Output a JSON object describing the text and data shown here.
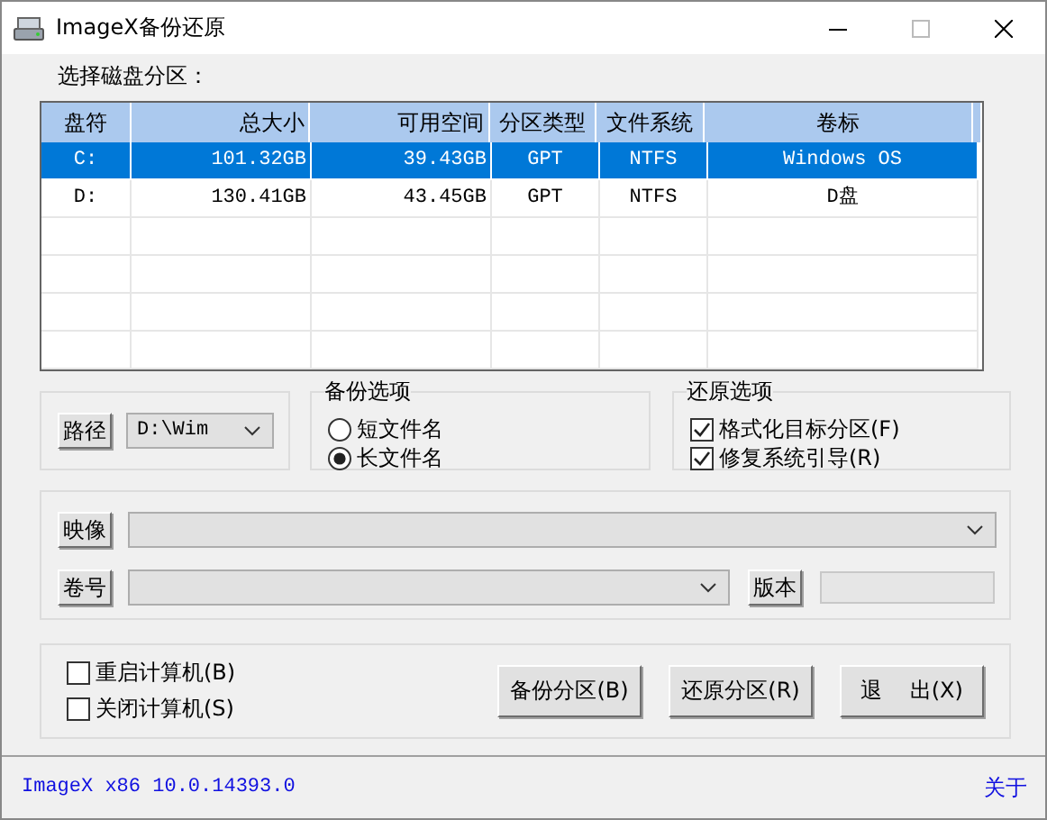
{
  "window": {
    "title": "ImageX备份还原"
  },
  "partition_label": "选择磁盘分区：",
  "table": {
    "columns": [
      "盘符",
      "总大小",
      "可用空间",
      "分区类型",
      "文件系统",
      "卷标"
    ],
    "rows": [
      {
        "selected": true,
        "cells": [
          "C:",
          "101.32GB",
          "39.43GB",
          "GPT",
          "NTFS",
          "Windows OS"
        ]
      },
      {
        "selected": false,
        "cells": [
          "D:",
          "130.41GB",
          "43.45GB",
          "GPT",
          "NTFS",
          "D盘"
        ]
      }
    ]
  },
  "path": {
    "button": "路径",
    "value": "D:\\Wim"
  },
  "backup_options": {
    "title": "备份选项",
    "options": [
      {
        "label": "短文件名",
        "selected": false
      },
      {
        "label": "长文件名",
        "selected": true
      }
    ]
  },
  "restore_options": {
    "title": "还原选项",
    "options": [
      {
        "label": "格式化目标分区(F)",
        "checked": true
      },
      {
        "label": "修复系统引导(R)",
        "checked": true
      }
    ]
  },
  "image": {
    "button": "映像"
  },
  "volume": {
    "button": "卷号",
    "version_button": "版本"
  },
  "power_options": [
    {
      "label": "重启计算机(B)",
      "checked": false
    },
    {
      "label": "关闭计算机(S)",
      "checked": false
    }
  ],
  "actions": [
    "备份分区(B)",
    "还原分区(R)",
    "退    出(X)"
  ],
  "status_bar": {
    "version": "ImageX x86 10.0.14393.0",
    "about": "关于"
  }
}
